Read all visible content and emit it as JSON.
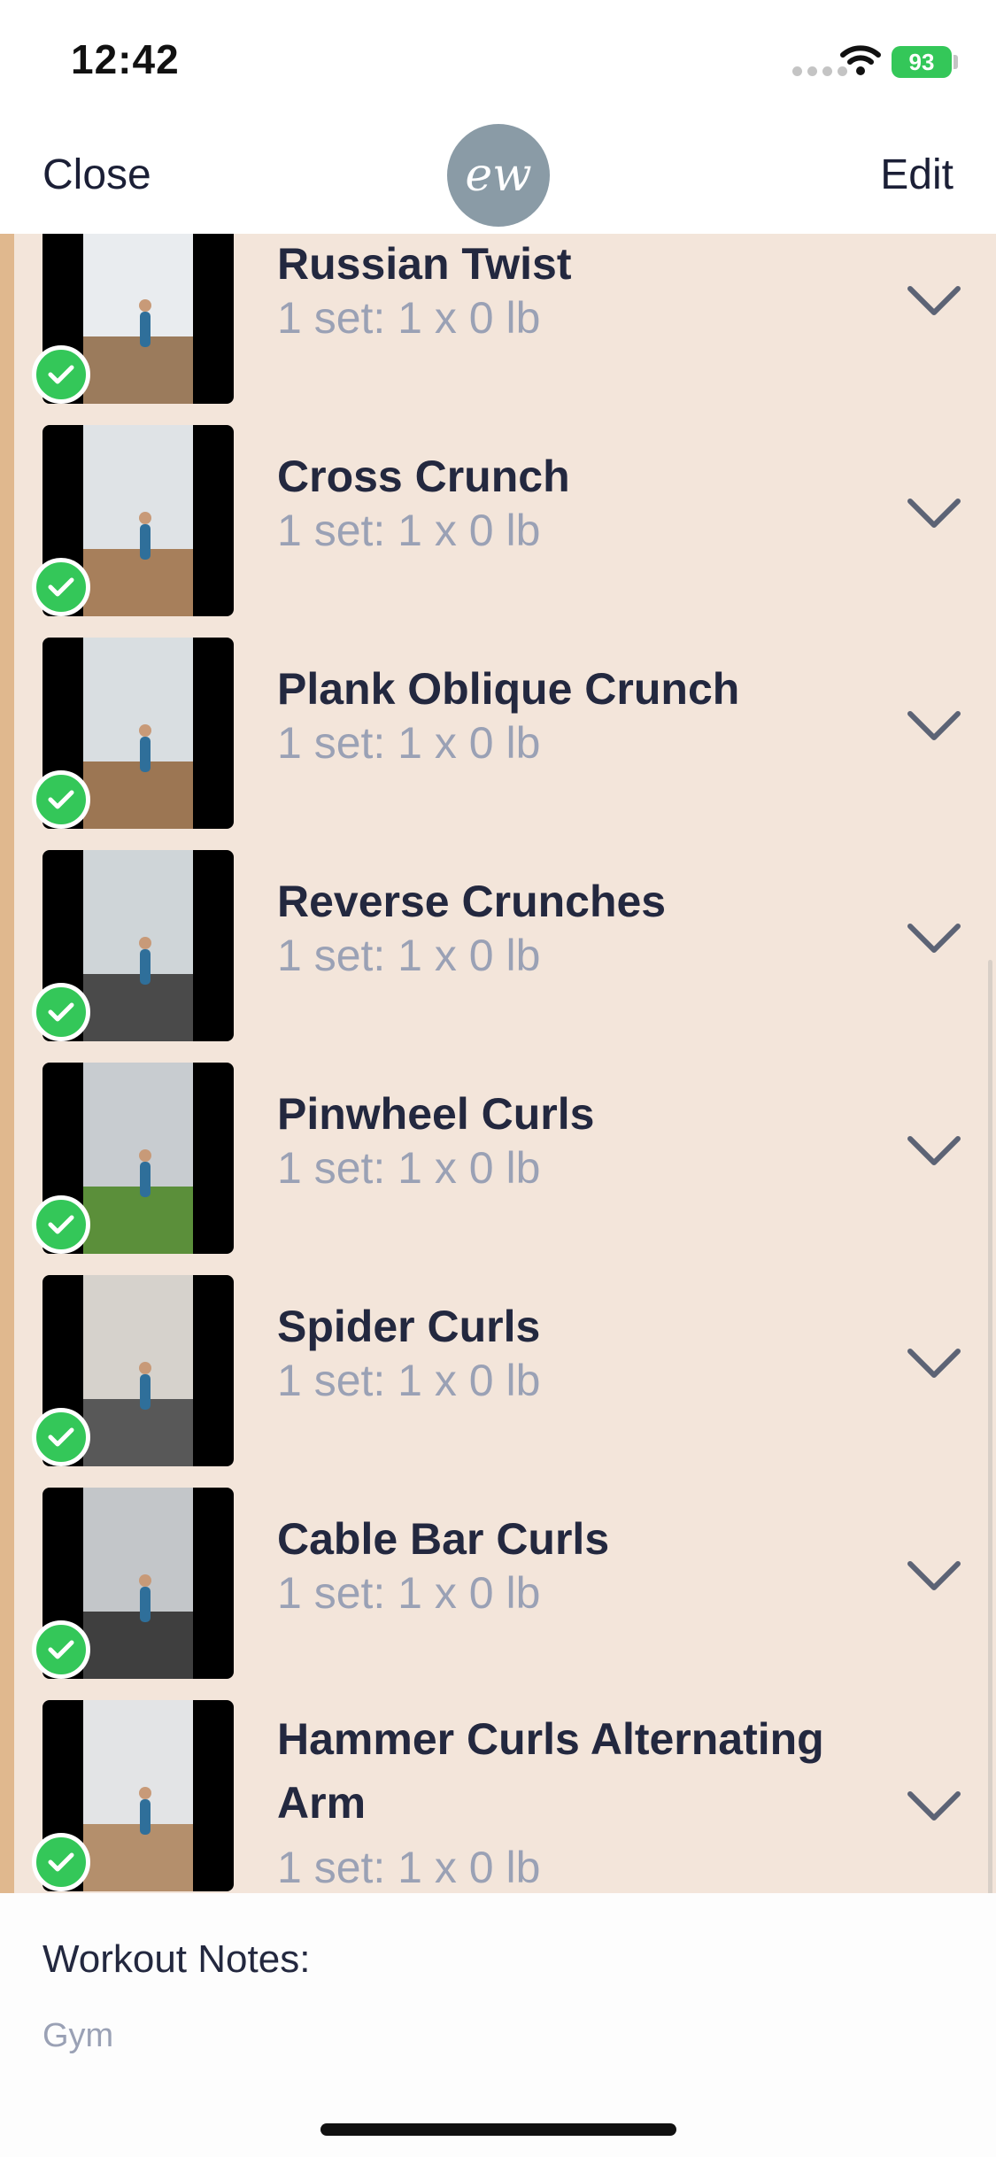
{
  "status_bar": {
    "time": "12:42",
    "battery": "93"
  },
  "nav": {
    "close_label": "Close",
    "edit_label": "Edit",
    "logo_text": "ew"
  },
  "colors": {
    "completed_check": "#34c759",
    "list_background": "#f3e5da",
    "group_bar": "#e0b88e"
  },
  "exercises": [
    {
      "name": "Russian Twist",
      "sets": "1 set: 1 x 0 lb",
      "completed": true
    },
    {
      "name": "Cross Crunch",
      "sets": "1 set: 1 x 0 lb",
      "completed": true
    },
    {
      "name": "Plank Oblique Crunch",
      "sets": "1 set: 1 x 0 lb",
      "completed": true
    },
    {
      "name": "Reverse Crunches",
      "sets": "1 set: 1 x 0 lb",
      "completed": true
    },
    {
      "name": "Pinwheel Curls",
      "sets": "1 set: 1 x 0 lb",
      "completed": true
    },
    {
      "name": "Spider Curls",
      "sets": "1 set: 1 x 0 lb",
      "completed": true
    },
    {
      "name": "Cable Bar Curls",
      "sets": "1 set: 1 x 0 lb",
      "completed": true
    },
    {
      "name": "Hammer Curls Alternating Arm",
      "sets": "1 set: 1 x 0 lb",
      "completed": true
    }
  ],
  "notes": {
    "label": "Workout Notes:",
    "value": "Gym"
  }
}
